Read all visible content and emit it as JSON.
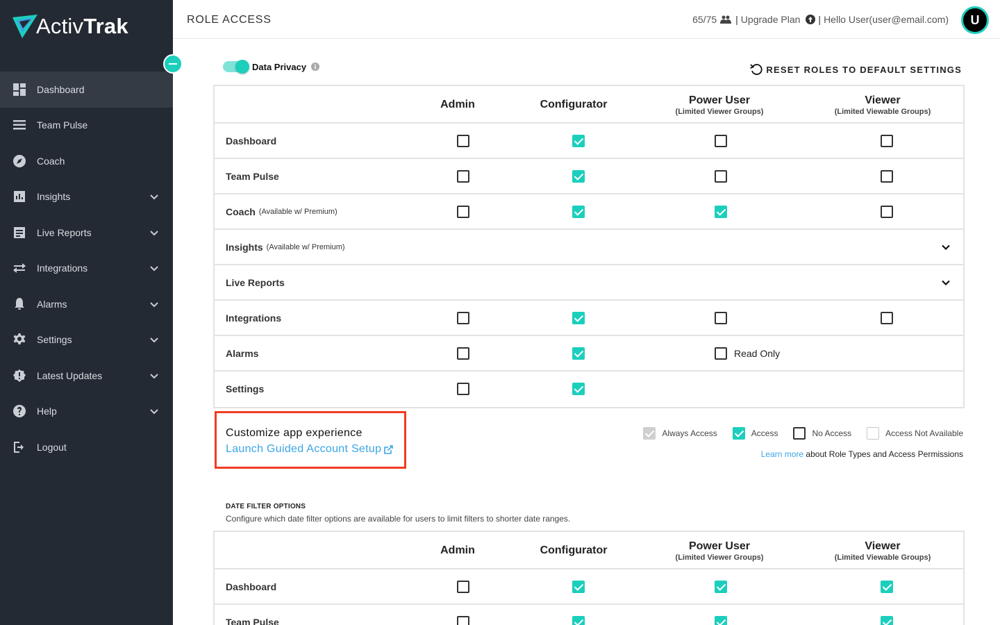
{
  "brand": {
    "logo_regular": "Activ",
    "logo_bold": "Trak",
    "accent": "#1ccfbd"
  },
  "sidebar": {
    "items": [
      {
        "label": "Dashboard",
        "icon": "dashboard-icon",
        "active": true,
        "chevron": false
      },
      {
        "label": "Team Pulse",
        "icon": "team-pulse-icon",
        "chevron": false
      },
      {
        "label": "Coach",
        "icon": "compass-icon",
        "chevron": false
      },
      {
        "label": "Insights",
        "icon": "insights-icon",
        "chevron": true
      },
      {
        "label": "Live Reports",
        "icon": "reports-icon",
        "chevron": true
      },
      {
        "label": "Integrations",
        "icon": "integrations-icon",
        "chevron": true
      },
      {
        "label": "Alarms",
        "icon": "bell-icon",
        "chevron": true
      },
      {
        "label": "Settings",
        "icon": "gear-icon",
        "chevron": true
      },
      {
        "label": "Latest Updates",
        "icon": "badge-icon",
        "chevron": true
      },
      {
        "label": "Help",
        "icon": "help-icon",
        "chevron": true
      },
      {
        "label": "Logout",
        "icon": "logout-icon",
        "chevron": false
      }
    ]
  },
  "header": {
    "title": "ROLE ACCESS",
    "license_count": "65/75",
    "upgrade": "Upgrade Plan",
    "hello": "Hello User",
    "email": "(user@email.com)",
    "avatar_initial": "U",
    "sep": "|"
  },
  "privacy": {
    "label": "Data Privacy",
    "enabled": true
  },
  "reset_label": "RESET ROLES TO DEFAULT SETTINGS",
  "columns": [
    {
      "name": "Admin",
      "sub": ""
    },
    {
      "name": "Configurator",
      "sub": ""
    },
    {
      "name": "Power User",
      "sub": "(Limited Viewer Groups)"
    },
    {
      "name": "Viewer",
      "sub": "(Limited Viewable Groups)"
    }
  ],
  "role_table": {
    "rows": [
      {
        "label": "Dashboard",
        "note": "",
        "cells": [
          "unchecked",
          "checked",
          "unchecked",
          "unchecked"
        ]
      },
      {
        "label": "Team Pulse",
        "note": "",
        "cells": [
          "unchecked",
          "checked",
          "unchecked",
          "unchecked"
        ]
      },
      {
        "label": "Coach",
        "note": "(Available w/ Premium)",
        "cells": [
          "unchecked",
          "checked",
          "checked",
          "unchecked"
        ]
      },
      {
        "label": "Insights",
        "note": "(Available w/ Premium)",
        "expandable": true
      },
      {
        "label": "Live Reports",
        "note": "",
        "expandable": true
      },
      {
        "label": "Integrations",
        "note": "",
        "cells": [
          "unchecked",
          "checked",
          "unchecked",
          "unchecked"
        ]
      },
      {
        "label": "Alarms",
        "note": "",
        "cells": [
          "unchecked",
          "checked",
          "readonly",
          "none"
        ],
        "readonly_label": "Read Only"
      },
      {
        "label": "Settings",
        "note": "",
        "cells": [
          "unchecked",
          "checked",
          "none",
          "none"
        ]
      }
    ]
  },
  "customize": {
    "title": "Customize app experience",
    "link": "Launch Guided Account Setup"
  },
  "legend": [
    {
      "label": "Always Access",
      "style": "gray"
    },
    {
      "label": "Access",
      "style": "checked"
    },
    {
      "label": "No Access",
      "style": "unchecked"
    },
    {
      "label": "Access Not Available",
      "style": "light"
    }
  ],
  "learn_more": {
    "link": "Learn more",
    "text": " about Role Types and Access Permissions"
  },
  "date_filter": {
    "title": "DATE FILTER OPTIONS",
    "description": "Configure which date filter options are available for users to limit filters to shorter date ranges.",
    "rows": [
      {
        "label": "Dashboard",
        "note": "",
        "cells": [
          "unchecked",
          "checked",
          "checked",
          "checked"
        ]
      },
      {
        "label": "Team Pulse",
        "note": "",
        "cells": [
          "unchecked",
          "checked",
          "checked",
          "checked"
        ]
      }
    ]
  }
}
